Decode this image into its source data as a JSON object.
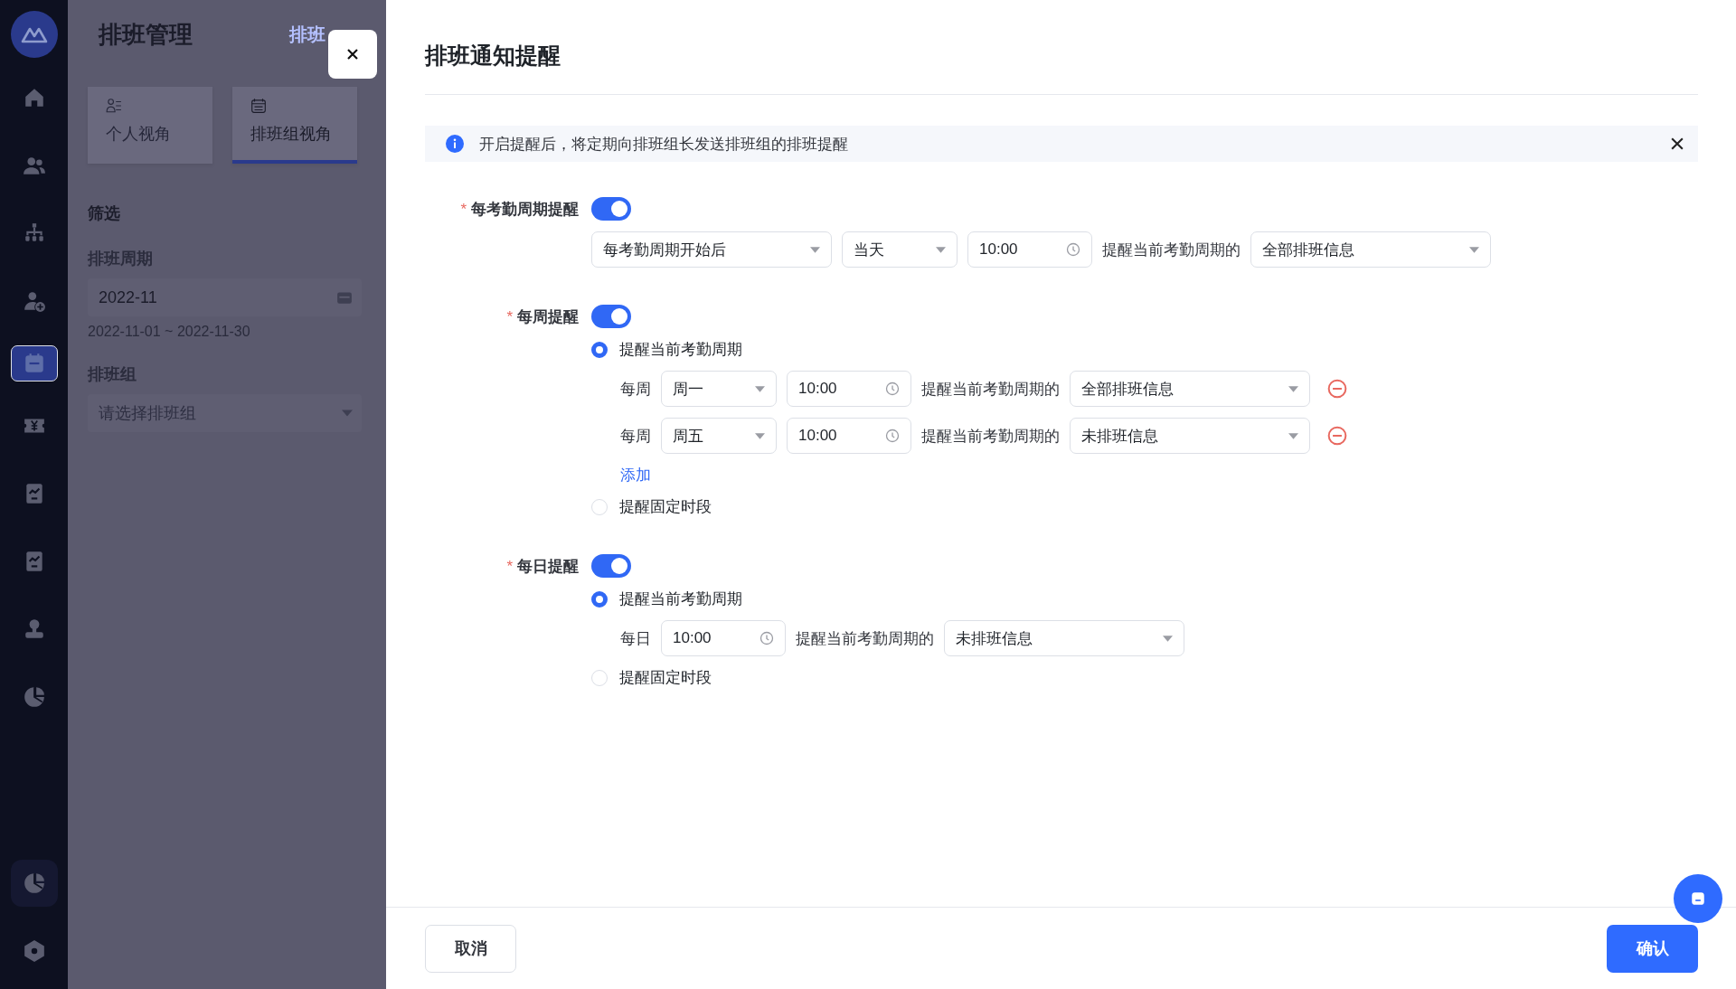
{
  "nav": {
    "items": [
      {
        "selected": false,
        "highlighted": false
      },
      {
        "selected": false,
        "highlighted": false
      },
      {
        "selected": false,
        "highlighted": false
      },
      {
        "selected": false,
        "highlighted": false
      },
      {
        "selected": true,
        "highlighted": false
      },
      {
        "selected": false,
        "highlighted": false
      },
      {
        "selected": false,
        "highlighted": false
      },
      {
        "selected": false,
        "highlighted": false
      },
      {
        "selected": false,
        "highlighted": false
      },
      {
        "selected": false,
        "highlighted": false
      }
    ],
    "bottom_items": [
      {
        "selected": false,
        "highlighted": true
      },
      {
        "selected": false,
        "highlighted": false
      }
    ]
  },
  "background_page": {
    "title": "排班管理",
    "link": "排班",
    "view_tabs": [
      {
        "label": "个人视角",
        "selected": false
      },
      {
        "label": "排班组视角",
        "selected": true
      }
    ],
    "filter_heading": "筛选",
    "period": {
      "label": "排班周期",
      "value": "2022-11",
      "range": "2022-11-01 ~ 2022-11-30"
    },
    "group": {
      "label": "排班组",
      "placeholder": "请选择排班组"
    }
  },
  "drawer": {
    "title": "排班通知提醒",
    "notice": "开启提醒后，将定期向排班组长发送排班组的排班提醒",
    "sections": [
      {
        "label": "每考勤周期提醒",
        "required_mark": "*",
        "on": true,
        "rows": [
          {
            "removable": false,
            "items": [
              {
                "kind": "select",
                "value": "每考勤周期开始后"
              },
              {
                "kind": "short_select",
                "value": "当天"
              },
              {
                "kind": "time",
                "value": "10:00"
              },
              {
                "kind": "text",
                "value": "提醒当前考勤周期的"
              },
              {
                "kind": "select",
                "value": "全部排班信息"
              }
            ]
          }
        ]
      },
      {
        "label": "每周提醒",
        "required_mark": "*",
        "on": true,
        "options": [
          {
            "label": "提醒当前考勤周期",
            "selected": true,
            "add_link": "添加",
            "rows": [
              {
                "removable": true,
                "items": [
                  {
                    "kind": "text",
                    "value": "每周"
                  },
                  {
                    "kind": "short_select",
                    "value": "周一"
                  },
                  {
                    "kind": "time",
                    "value": "10:00"
                  },
                  {
                    "kind": "text",
                    "value": "提醒当前考勤周期的"
                  },
                  {
                    "kind": "select",
                    "value": "全部排班信息"
                  }
                ]
              },
              {
                "removable": true,
                "items": [
                  {
                    "kind": "text",
                    "value": "每周"
                  },
                  {
                    "kind": "short_select",
                    "value": "周五"
                  },
                  {
                    "kind": "time",
                    "value": "10:00"
                  },
                  {
                    "kind": "text",
                    "value": "提醒当前考勤周期的"
                  },
                  {
                    "kind": "select",
                    "value": "未排班信息"
                  }
                ]
              }
            ]
          },
          {
            "label": "提醒固定时段",
            "selected": false
          }
        ]
      },
      {
        "label": "每日提醒",
        "required_mark": "*",
        "on": true,
        "options": [
          {
            "label": "提醒当前考勤周期",
            "selected": true,
            "rows": [
              {
                "removable": false,
                "items": [
                  {
                    "kind": "text",
                    "value": "每日"
                  },
                  {
                    "kind": "time",
                    "value": "10:00"
                  },
                  {
                    "kind": "text",
                    "value": "提醒当前考勤周期的"
                  },
                  {
                    "kind": "select",
                    "value": "未排班信息"
                  }
                ]
              }
            ]
          },
          {
            "label": "提醒固定时段",
            "selected": false
          }
        ]
      }
    ],
    "cancel": "取消",
    "confirm": "确认"
  }
}
